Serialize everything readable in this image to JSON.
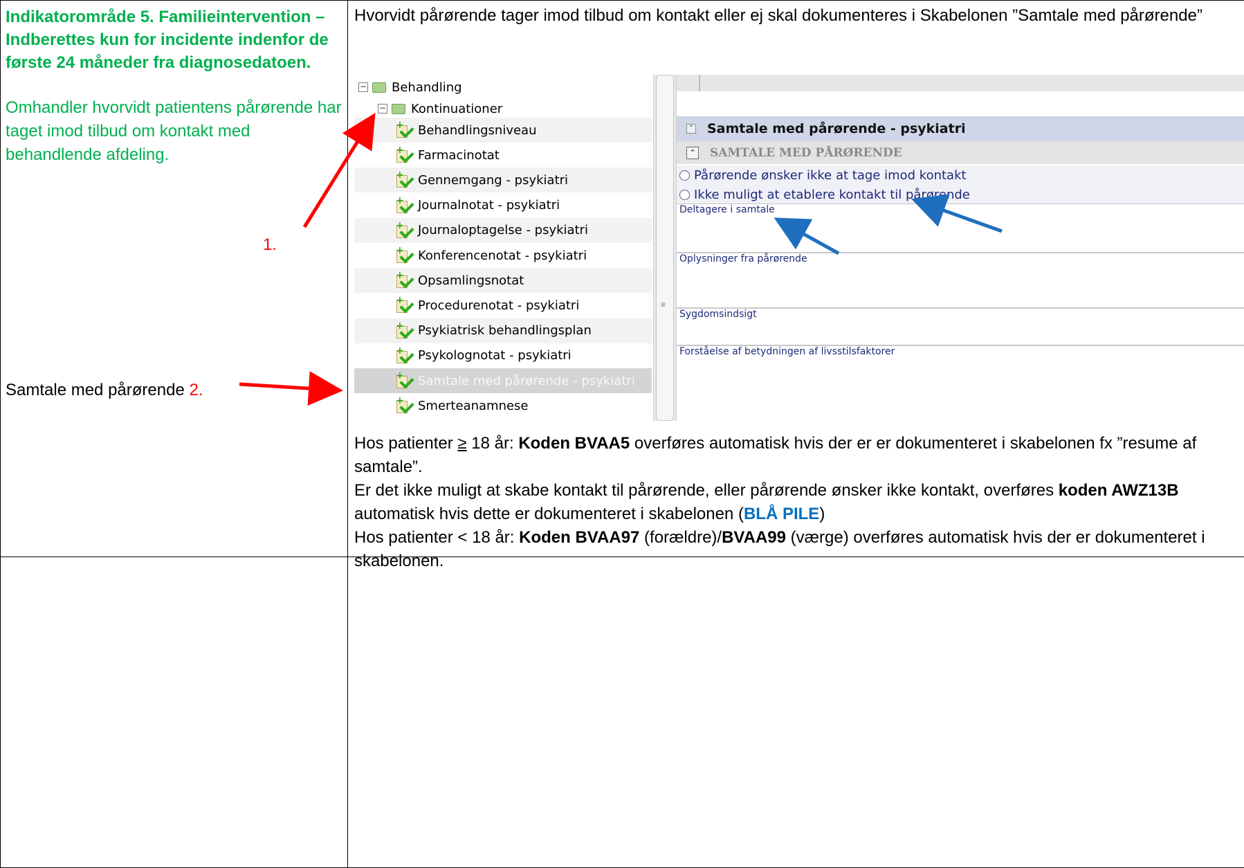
{
  "left": {
    "heading": "Indikatorområde 5. Familieintervention – Indberettes kun for incidente indenfor de første 24 måneder fra diagnosedatoen.",
    "description": "Omhandler hvorvidt patientens pårørende har taget imod tilbud om kontakt med behandlende afdeling.",
    "label1": "1.",
    "label2_text": "Samtale med pårørende ",
    "label2_num": "2."
  },
  "right": {
    "intro": "Hvorvidt pårørende tager imod tilbud om kontakt eller ej skal dokumenteres i Skabelonen ”Samtale med pårørende”"
  },
  "tree": {
    "root": "Behandling",
    "child": "Kontinuationer",
    "items": [
      "Behandlingsniveau",
      "Farmacinotat",
      "Gennemgang - psykiatri",
      "Journalnotat - psykiatri",
      "Journaloptagelse - psykiatri",
      "Konferencenotat - psykiatri",
      "Opsamlingsnotat",
      "Procedurenotat - psykiatri",
      "Psykiatrisk behandlingsplan",
      "Psykolognotat - psykiatri",
      "Samtale med pårørende - psykiatri",
      "Smerteanamnese"
    ],
    "selected_index": 10
  },
  "form": {
    "title": "Samtale med pårørende - psykiatri",
    "subtitle": "SAMTALE MED PÅRØRENDE",
    "options": [
      "Pårørende ønsker ikke at tage imod kontakt",
      "Ikke muligt at etablere kontakt til pårørende"
    ],
    "fields": [
      "Deltagere i samtale",
      "Oplysninger fra pårørende",
      "Sygdomsindsigt",
      "Forståelse af betydningen af livsstilsfaktorer"
    ]
  },
  "body": {
    "p1_a": "Hos patienter ",
    "p1_ge": "≥",
    "p1_b": " 18 år: ",
    "p1_code": "Koden BVAA5",
    "p1_c": " overføres automatisk hvis der er er dokumenteret i skabelonen fx ”resume af samtale”.",
    "p2_a": "Er det ikke muligt at skabe kontakt til pårørende, eller pårørende ønsker ikke kontakt, overføres ",
    "p2_code": "koden AWZ13B",
    "p2_b": " automatisk hvis dette er dokumenteret i skabelonen (",
    "p2_blue": "BLÅ PILE",
    "p2_c": ")",
    "p3_a": "Hos patienter < 18 år: ",
    "p3_code1": "Koden BVAA97",
    "p3_b": " (forældre)/",
    "p3_code2": "BVAA99",
    "p3_c": " (værge) overføres automatisk hvis der er dokumenteret i skabelonen."
  },
  "colors": {
    "green": "#00b050",
    "red": "#ff0000",
    "blue": "#0070c0"
  }
}
